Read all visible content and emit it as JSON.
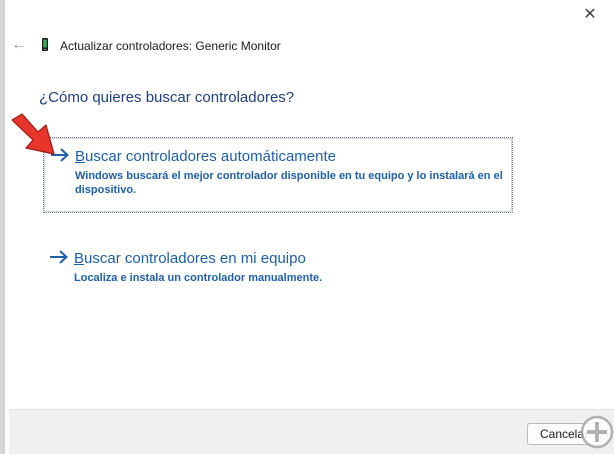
{
  "window": {
    "title": "Actualizar controladores: Generic Monitor",
    "close_glyph": "✕",
    "back_glyph": "←"
  },
  "question": "¿Cómo quieres buscar controladores?",
  "options": [
    {
      "title_first": "B",
      "title_rest": "uscar controladores automáticamente",
      "description": "Windows buscará el mejor controlador disponible en tu equipo y lo instalará en el dispositivo."
    },
    {
      "title_first": "B",
      "title_rest": "uscar controladores en mi equipo",
      "description": "Localiza e instala un controlador manualmente."
    }
  ],
  "footer": {
    "cancel_label": "Cancelar"
  },
  "colors": {
    "link_blue": "#1e5fa8",
    "question_blue": "#1f3f7f",
    "annotation_red": "#e8352b"
  },
  "icons": {
    "back": "arrow-left-icon",
    "device": "monitor-icon",
    "option": "arrow-right-icon",
    "annotation": "red-pointer-arrow-icon",
    "watermark": "solvetic-logo-icon"
  }
}
